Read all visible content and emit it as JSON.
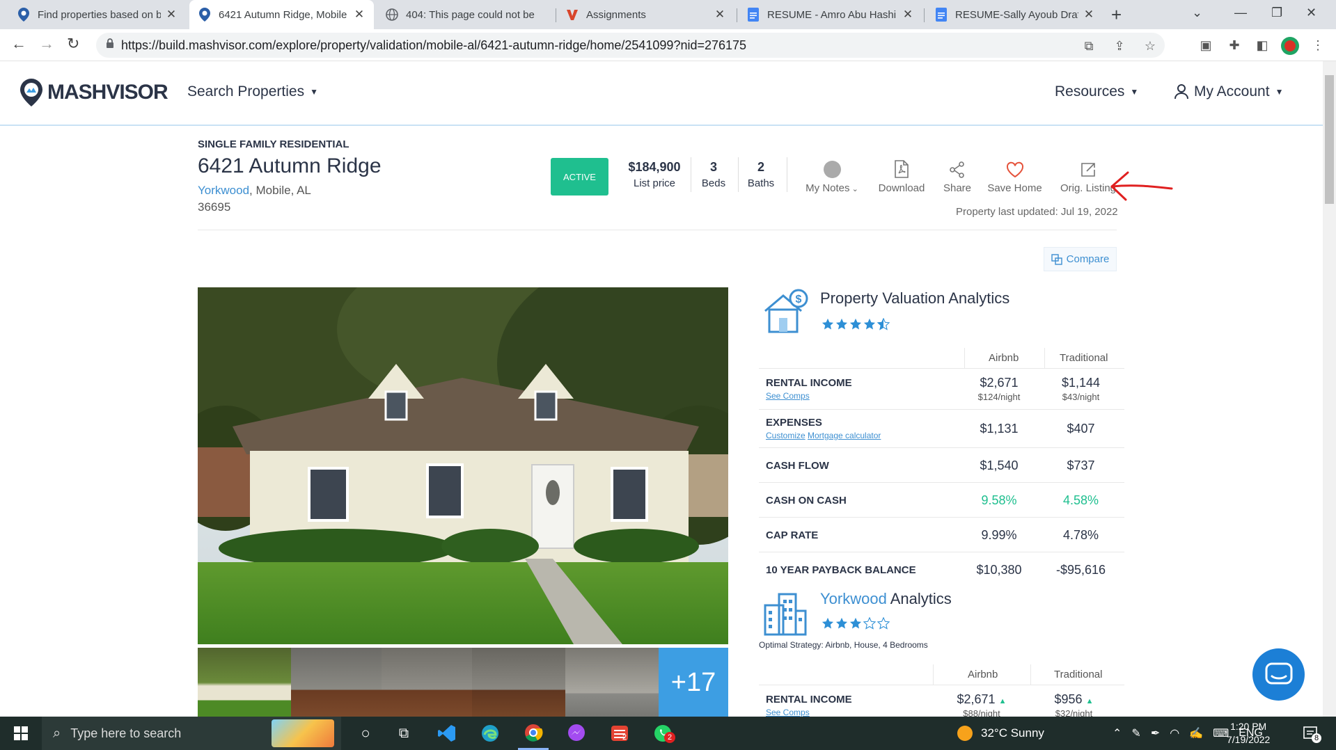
{
  "browser": {
    "tabs": [
      {
        "title": "Find properties based on be",
        "active": false
      },
      {
        "title": "6421 Autumn Ridge, Mobile",
        "active": true
      },
      {
        "title": "404: This page could not be",
        "active": false
      },
      {
        "title": "Assignments",
        "active": false
      },
      {
        "title": "RESUME - Amro Abu Hashi",
        "active": false
      },
      {
        "title": "RESUME-Sally Ayoub Draft",
        "active": false
      }
    ],
    "url": "https://build.mashvisor.com/explore/property/validation/mobile-al/6421-autumn-ridge/home/2541099?nid=276175"
  },
  "site": {
    "logo": "MASHVISOR",
    "nav": {
      "search": "Search Properties",
      "resources": "Resources",
      "account": "My Account"
    }
  },
  "property": {
    "type": "SINGLE FAMILY RESIDENTIAL",
    "address": "6421 Autumn Ridge",
    "neighborhood": "Yorkwood",
    "city": ", Mobile, AL",
    "zip": "36695",
    "status": "ACTIVE",
    "price": "$184,900",
    "price_label": "List price",
    "beds": "3",
    "beds_label": "Beds",
    "baths": "2",
    "baths_label": "Baths",
    "updated": "Property last updated: Jul 19, 2022",
    "more_photos": "+17"
  },
  "actions": {
    "notes": "My Notes",
    "download": "Download",
    "share": "Share",
    "save": "Save Home",
    "orig": "Orig. Listing",
    "compare": "Compare"
  },
  "pva": {
    "title": "Property Valuation Analytics",
    "rating": 4.5,
    "col_airbnb": "Airbnb",
    "col_traditional": "Traditional",
    "rows": [
      {
        "label": "RENTAL INCOME",
        "links": [
          "See Comps"
        ],
        "airbnb": "$2,671",
        "airbnb_night": "$124/night",
        "traditional": "$1,144",
        "traditional_night": "$43/night"
      },
      {
        "label": "EXPENSES",
        "links": [
          "Customize",
          "Mortgage calculator"
        ],
        "airbnb": "$1,131",
        "traditional": "$407"
      },
      {
        "label": "CASH FLOW",
        "airbnb": "$1,540",
        "traditional": "$737"
      },
      {
        "label": "CASH ON CASH",
        "airbnb": "9.58%",
        "traditional": "4.58%"
      },
      {
        "label": "CAP RATE",
        "airbnb": "9.99%",
        "traditional": "4.78%"
      },
      {
        "label": "10 YEAR PAYBACK BALANCE",
        "airbnb": "$10,380",
        "traditional": "-$95,616"
      }
    ]
  },
  "neigh": {
    "name": "Yorkwood",
    "title_suffix": " Analytics",
    "rating": 3,
    "optimal": "Optimal Strategy: Airbnb, House, 4 Bedrooms",
    "col_airbnb": "Airbnb",
    "col_traditional": "Traditional",
    "rental_label": "RENTAL INCOME",
    "rental_link": "See Comps",
    "airbnb": "$2,671",
    "airbnb_night": "$88/night",
    "traditional": "$956",
    "traditional_night": "$32/night"
  },
  "taskbar": {
    "search_placeholder": "Type here to search",
    "weather": "32°C  Sunny",
    "lang": "ENG",
    "time": "1:20 PM",
    "date": "7/19/2022",
    "notif_count": "8",
    "todoist_badge": "2",
    "whatsapp_badge": "2"
  },
  "colors": {
    "brand": "#2b3447",
    "accent": "#3d8fd1",
    "positive": "#1fbf8f",
    "active_badge": "#1fbf8f",
    "annotation": "#e02020"
  }
}
